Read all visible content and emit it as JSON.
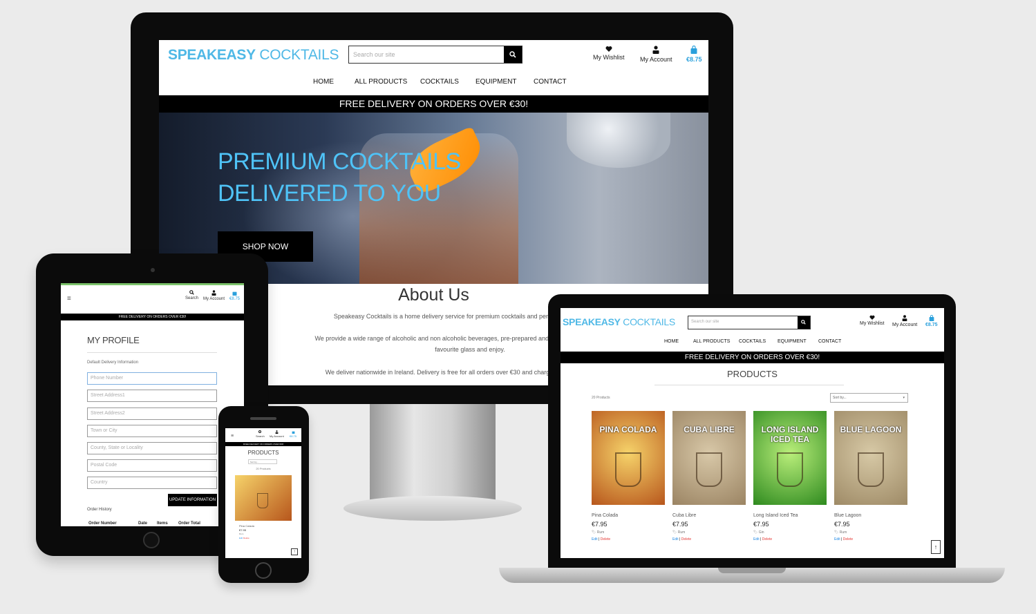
{
  "brand": {
    "part1": "SPEAKEASY",
    "part2": "COCKTAILS"
  },
  "desktop": {
    "search_placeholder": "Search our site",
    "wishlist_label": "My Wishlist",
    "account_label": "My Account",
    "cart_total": "€8.75",
    "nav": [
      "HOME",
      "ALL PRODUCTS",
      "COCKTAILS",
      "EQUIPMENT",
      "CONTACT"
    ],
    "banner": "FREE DELIVERY ON ORDERS OVER €30!",
    "hero": {
      "line1": "PREMIUM COCKTAILS",
      "line2": "DELIVERED TO YOU",
      "button": "SHOP NOW"
    },
    "about": {
      "title": "About Us",
      "p1": "Speakeasy Cocktails is a home delivery service for premium cocktails and personal bar equipment.",
      "p2a": "We provide a wide range of alcoholic and non alcoholic beverages, pre-prepared and ready to drink, all you need",
      "p2b": "favourite glass and enjoy.",
      "p3": "We deliver nationwide in Ireland. Delivery is free for all orders over €30 and charged at 10% of your order"
    }
  },
  "tablet": {
    "menu_icon": "≡",
    "search_label": "Search",
    "account_label": "My Account",
    "cart_total": "€8.75",
    "banner": "FREE DELIVERY ON ORDERS OVER €30!",
    "title": "MY PROFILE",
    "section_label": "Default Delivery Information",
    "fields": [
      "Phone Number",
      "Street Address1",
      "Street Address2",
      "Town or City",
      "County, State or Locality",
      "Postal Code",
      "Country"
    ],
    "update_button": "UPDATE INFORMATION",
    "order_history": "Order History",
    "columns": [
      "Order Number",
      "Date",
      "Items",
      "Order Total"
    ]
  },
  "phone": {
    "menu_icon": "≡",
    "search_label": "Search",
    "account_label": "My Account",
    "cart_total": "€8.75",
    "banner": "FREE DELIVERY ON ORDERS OVER €30!",
    "title": "PRODUCTS",
    "sort_label": "Sort by...",
    "count": "20 Products",
    "product_name": "Pina Colada",
    "product_price": "€7.95",
    "product_category": "Rum",
    "edit": "Edit",
    "delete": "Delete"
  },
  "laptop": {
    "search_placeholder": "Search our site",
    "wishlist_label": "My Wishlist",
    "account_label": "My Account",
    "cart_total": "€8.75",
    "nav": [
      "HOME",
      "ALL PRODUCTS",
      "COCKTAILS",
      "EQUIPMENT",
      "CONTACT"
    ],
    "banner": "FREE DELIVERY ON ORDERS OVER €30!",
    "title": "PRODUCTS",
    "count": "20 Products",
    "sort_label": "Sort by...",
    "products": [
      {
        "name": "Pina Colada",
        "price": "€7.95",
        "category": "Rum",
        "edit": "Edit",
        "delete": "Delete",
        "poster": "PINA COLADA",
        "colors": [
          "#f6d36a",
          "#b7561c"
        ]
      },
      {
        "name": "Cuba Libre",
        "price": "€7.95",
        "category": "Rum",
        "edit": "Edit",
        "delete": "Delete",
        "poster": "CUBA LIBRE",
        "colors": [
          "#d8c8a8",
          "#9b8463"
        ]
      },
      {
        "name": "Long Island Iced Tea",
        "price": "€7.95",
        "category": "Gin",
        "edit": "Edit",
        "delete": "Delete",
        "poster": "LONG ISLAND ICED TEA",
        "colors": [
          "#b9ee7a",
          "#2e8a1f"
        ]
      },
      {
        "name": "Blue Lagoon",
        "price": "€7.95",
        "category": "Rum",
        "edit": "Edit",
        "delete": "Delete",
        "poster": "BLUE LAGOON",
        "colors": [
          "#d7c9a6",
          "#9e8a66"
        ]
      }
    ]
  },
  "colors": {
    "brand": "#4fb8e6",
    "banner_bg": "#000000",
    "hero_text": "#4fc3f7",
    "edit": "#1e88e5",
    "delete": "#e53935"
  }
}
